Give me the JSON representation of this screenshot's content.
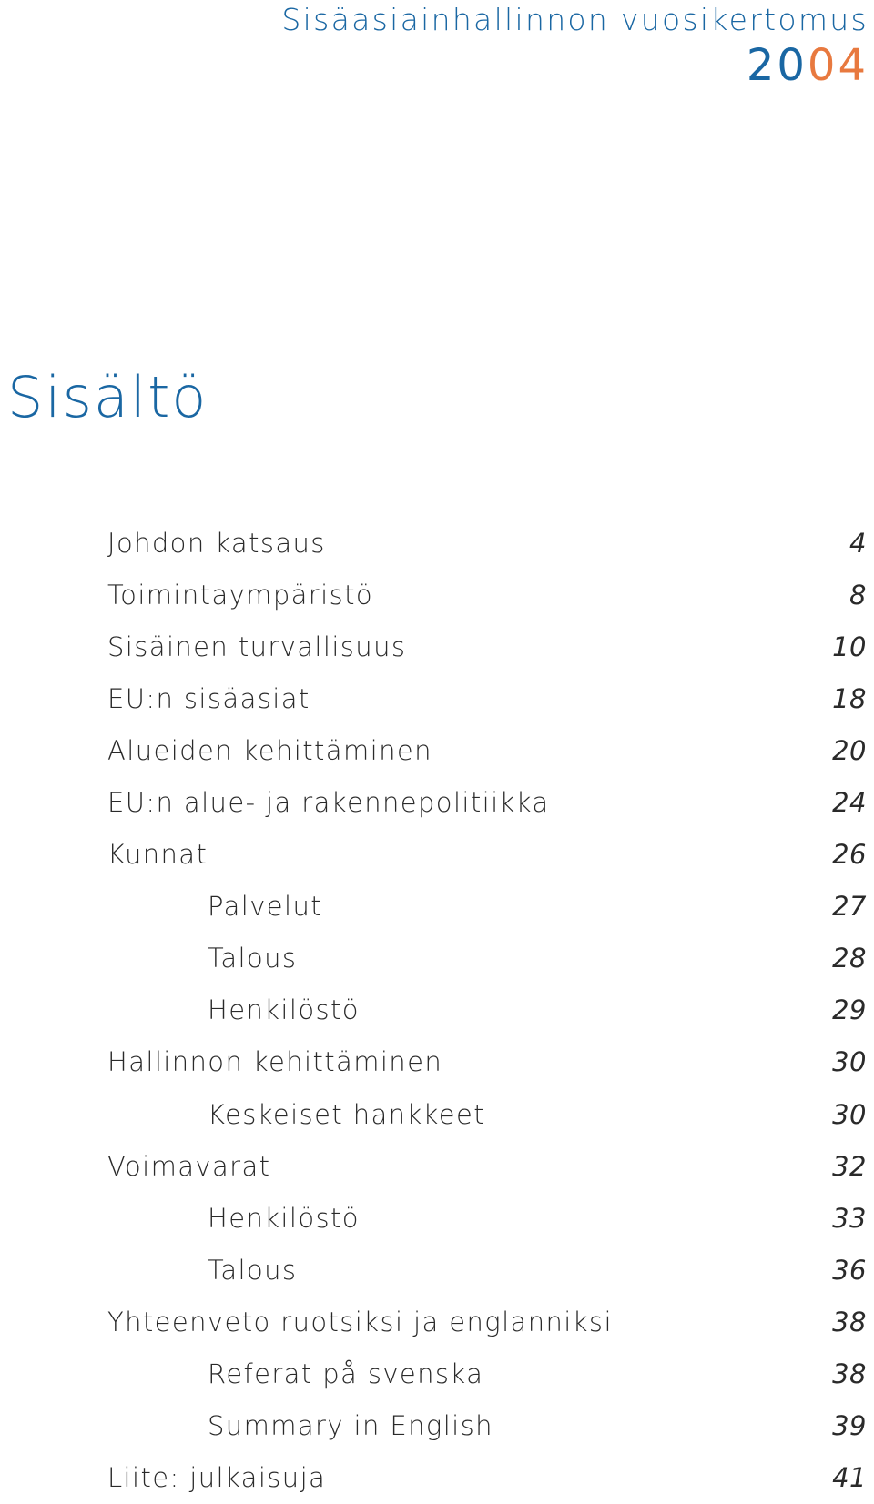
{
  "header": {
    "report_title": "Sisäasiainhallinnon vuosikertomus",
    "year_part_blue": "20",
    "year_part_orange": "04"
  },
  "colors": {
    "brand_blue": "#1a67a3",
    "accent_orange": "#e8793f",
    "text": "#2a2a2a"
  },
  "page_title": "Sisältö",
  "toc": [
    {
      "label": "Johdon katsaus",
      "page": "4",
      "level": 1
    },
    {
      "label": "Toimintaympäristö",
      "page": "8",
      "level": 1
    },
    {
      "label": "Sisäinen turvallisuus",
      "page": "10",
      "level": 1
    },
    {
      "label": "EU:n sisäasiat",
      "page": "18",
      "level": 1
    },
    {
      "label": "Alueiden kehittäminen",
      "page": "20",
      "level": 1
    },
    {
      "label": "EU:n alue- ja rakennepolitiikka",
      "page": "24",
      "level": 1
    },
    {
      "label": "Kunnat",
      "page": "26",
      "level": 1
    },
    {
      "label": "Palvelut",
      "page": "27",
      "level": 2
    },
    {
      "label": "Talous",
      "page": "28",
      "level": 2
    },
    {
      "label": "Henkilöstö",
      "page": "29",
      "level": 2
    },
    {
      "label": "Hallinnon kehittäminen",
      "page": "30",
      "level": 1
    },
    {
      "label": "Keskeiset hankkeet",
      "page": "30",
      "level": 2
    },
    {
      "label": "Voimavarat",
      "page": "32",
      "level": 1
    },
    {
      "label": "Henkilöstö",
      "page": "33",
      "level": 2
    },
    {
      "label": "Talous",
      "page": "36",
      "level": 2
    },
    {
      "label": "Yhteenveto ruotsiksi ja englanniksi",
      "page": "38",
      "level": 1
    },
    {
      "label": "Referat på svenska",
      "page": "38",
      "level": 2
    },
    {
      "label": "Summary in English",
      "page": "39",
      "level": 2
    },
    {
      "label": "Liite: julkaisuja",
      "page": "41",
      "level": 1
    }
  ]
}
